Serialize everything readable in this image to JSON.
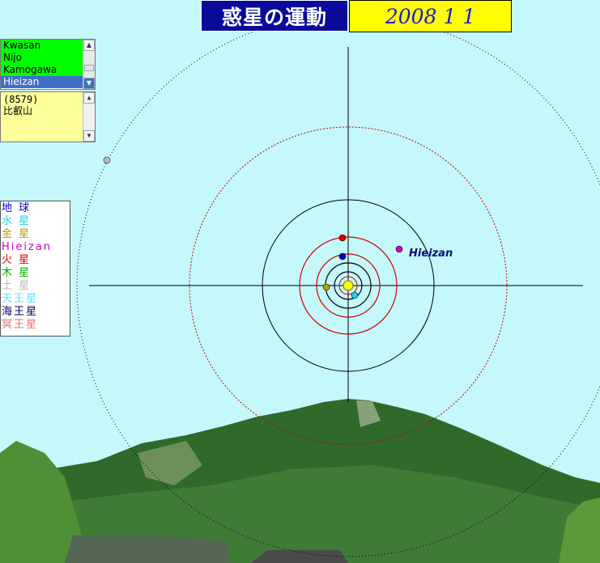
{
  "header": {
    "title": "惑星の運動",
    "date": "2008 1 1"
  },
  "locations": {
    "items": [
      "Kwasan",
      "Nijo",
      "Kamogawa",
      "Hieizan"
    ],
    "selected": "Hieizan"
  },
  "info": {
    "line1": "(8579)",
    "line2": "比叡山"
  },
  "legend": [
    {
      "label": "地 球",
      "color": "#0000cc"
    },
    {
      "label": "水 星",
      "color": "#22d0e8"
    },
    {
      "label": "金 星",
      "color": "#b8a000"
    },
    {
      "label": "Hieizan",
      "color": "#cc00cc"
    },
    {
      "label": "火 星",
      "color": "#dd0000"
    },
    {
      "label": "木 星",
      "color": "#00b000"
    },
    {
      "label": "土 星",
      "color": "#bbbbbb"
    },
    {
      "label": "天王星",
      "color": "#60e0f0"
    },
    {
      "label": "海王星",
      "color": "#000066"
    },
    {
      "label": "冥王星",
      "color": "#e07070"
    }
  ],
  "plot": {
    "body_label": "Hieizan"
  },
  "icons": {
    "scroll_up": "scroll-up-arrow",
    "scroll_down": "scroll-down-arrow"
  }
}
